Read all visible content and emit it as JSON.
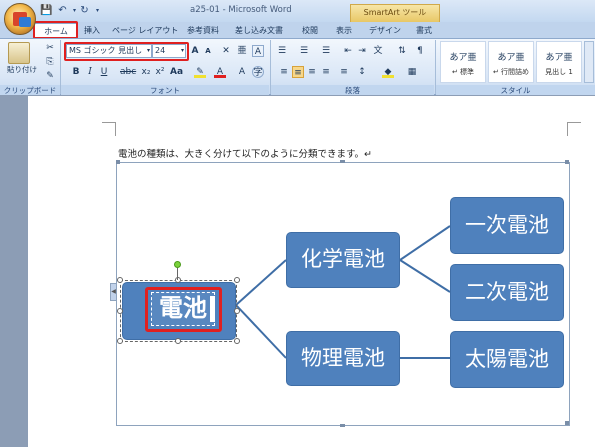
{
  "window": {
    "title": "a25-01 - Microsoft Word",
    "context_tab": "SmartArt ツール"
  },
  "tabs": [
    "ホーム",
    "挿入",
    "ページ レイアウト",
    "参考資料",
    "差し込み文書",
    "校閲",
    "表示",
    "デザイン",
    "書式"
  ],
  "ribbon": {
    "clipboard": {
      "paste_label": "貼り付け",
      "group_label": "クリップボード"
    },
    "font": {
      "name": "MS ゴシック 見出し",
      "size": "24",
      "group_label": "フォント"
    },
    "paragraph": {
      "group_label": "段落"
    },
    "styles": {
      "group_label": "スタイル",
      "items": [
        {
          "sample": "あア亜",
          "name": "↵ 標準"
        },
        {
          "sample": "あア亜",
          "name": "↵ 行間詰め"
        },
        {
          "sample": "あア亜",
          "name": "見出し 1"
        }
      ]
    }
  },
  "document": {
    "paragraph": "電池の種類は、大きく分けて以下のように分類できます。↵"
  },
  "smartart": {
    "root": "電池",
    "level1": [
      "化学電池",
      "物理電池"
    ],
    "level2": [
      "一次電池",
      "二次電池",
      "太陽電池"
    ]
  },
  "colors": {
    "node_fill": "#4f81bd",
    "highlight": "#e02020",
    "ribbon": "#dbe7f6"
  }
}
